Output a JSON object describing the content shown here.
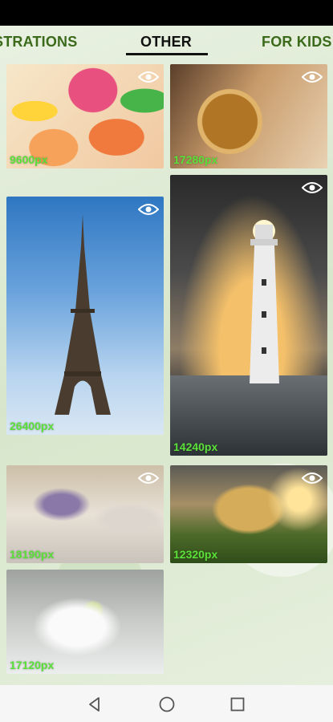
{
  "tabs": [
    {
      "label": "STRATIONS"
    },
    {
      "label": "OTHER"
    },
    {
      "label": "FOR KIDS"
    }
  ],
  "gallery": [
    {
      "points": "9600px",
      "subject": "citrus slices"
    },
    {
      "points": "17280px",
      "subject": "pocket watch"
    },
    {
      "points": "26400px",
      "subject": "eiffel tower"
    },
    {
      "points": "14240px",
      "subject": "lighthouse"
    },
    {
      "points": "18190px",
      "subject": "dancer"
    },
    {
      "points": "12320px",
      "subject": "book landscape"
    },
    {
      "points": "17120px",
      "subject": "tea set"
    }
  ],
  "colors": {
    "active_tab": "#111111",
    "inactive_tab": "#3b6b1a",
    "points_label": "#5be03a"
  },
  "icons": {
    "preview": "eye-icon",
    "back": "nav-back-icon",
    "home": "nav-home-icon",
    "recent": "nav-recent-icon"
  }
}
